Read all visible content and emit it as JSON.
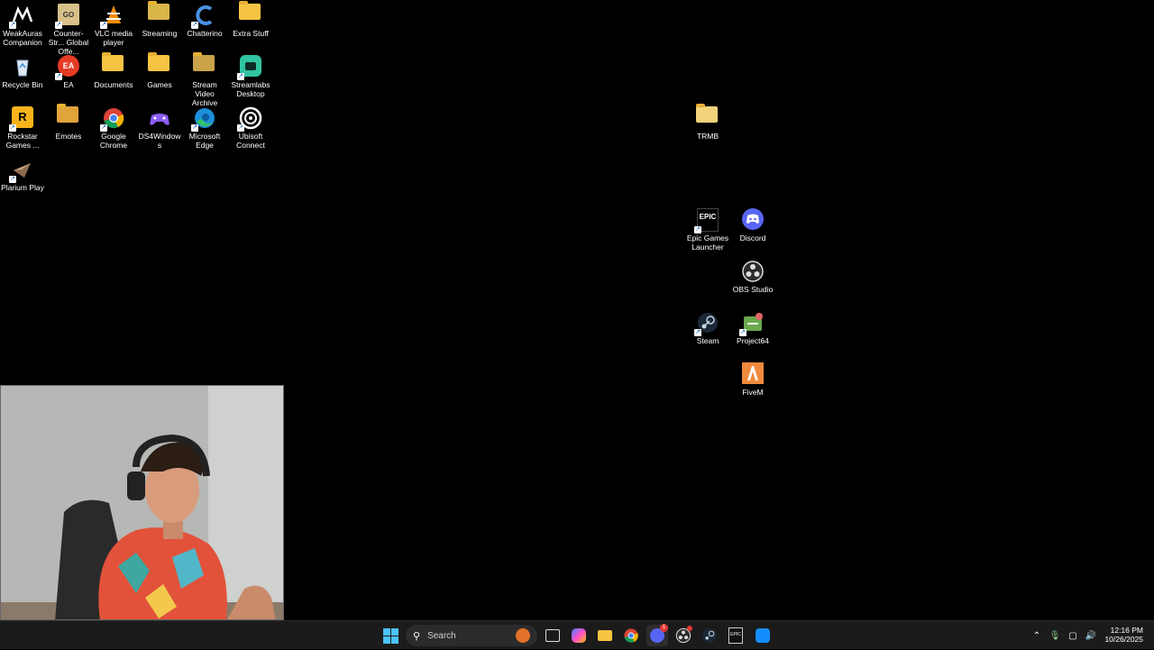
{
  "desktop": {
    "icons": [
      {
        "label": "WeakAuras Companion",
        "icon": "weakauras-icon"
      },
      {
        "label": "Counter-Str... Global Offe...",
        "icon": "csgo-icon"
      },
      {
        "label": "VLC media player",
        "icon": "vlc-icon"
      },
      {
        "label": "Streaming",
        "icon": "folder-icon"
      },
      {
        "label": "Chatterino",
        "icon": "chatterino-icon"
      },
      {
        "label": "Extra Stuff",
        "icon": "folder-icon"
      },
      {
        "label": "Recycle Bin",
        "icon": "recycle-bin-icon"
      },
      {
        "label": "EA",
        "icon": "ea-icon"
      },
      {
        "label": "Documents",
        "icon": "folder-icon"
      },
      {
        "label": "Games",
        "icon": "folder-icon"
      },
      {
        "label": "Stream Video Archive",
        "icon": "folder-icon"
      },
      {
        "label": "Streamlabs Desktop",
        "icon": "streamlabs-icon"
      },
      {
        "label": "Rockstar Games ...",
        "icon": "rockstar-icon"
      },
      {
        "label": "Emotes",
        "icon": "folder-icon"
      },
      {
        "label": "Google Chrome",
        "icon": "chrome-icon"
      },
      {
        "label": "DS4Windows",
        "icon": "gamepad-icon"
      },
      {
        "label": "Microsoft Edge",
        "icon": "edge-icon"
      },
      {
        "label": "Ubisoft Connect",
        "icon": "ubisoft-icon"
      },
      {
        "label": "Plarium Play",
        "icon": "plarium-icon"
      },
      {
        "label": "TRMB",
        "icon": "folder-icon"
      },
      {
        "label": "Epic Games Launcher",
        "icon": "epic-games-icon"
      },
      {
        "label": "Discord",
        "icon": "discord-icon"
      },
      {
        "label": "OBS Studio",
        "icon": "obs-icon"
      },
      {
        "label": "Steam",
        "icon": "steam-icon"
      },
      {
        "label": "Project64",
        "icon": "project64-icon"
      },
      {
        "label": "FiveM",
        "icon": "fivem-icon"
      }
    ]
  },
  "webcam": {
    "description_icon": "webcam-overlay"
  },
  "taskbar": {
    "search_placeholder": "Search",
    "pinned": [
      {
        "name": "task-view-icon"
      },
      {
        "name": "copilot-icon"
      },
      {
        "name": "file-explorer-icon"
      },
      {
        "name": "chrome-icon"
      },
      {
        "name": "discord-icon",
        "badge": "1"
      },
      {
        "name": "obs-icon"
      },
      {
        "name": "steam-icon"
      },
      {
        "name": "epic-games-icon"
      },
      {
        "name": "battle-net-icon"
      }
    ],
    "clock": {
      "time": "12:16 PM",
      "date": "10/26/2025"
    }
  },
  "colors": {
    "taskbar_bg": "#1b1b1b",
    "accent": "#0078d4",
    "desktop_bg": "#000000"
  }
}
